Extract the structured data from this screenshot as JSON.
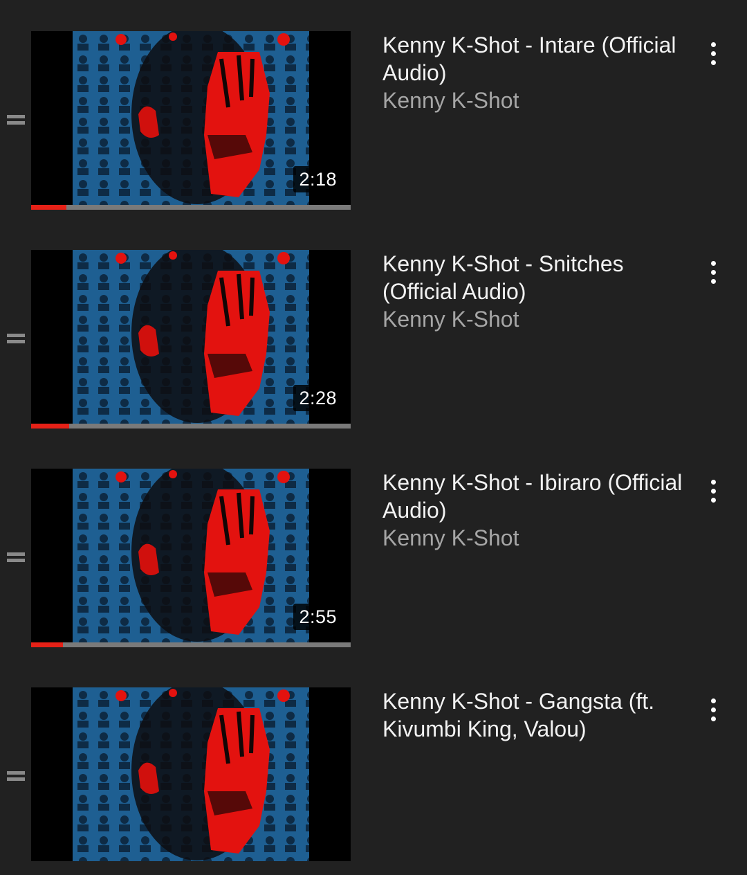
{
  "theme": {
    "background": "#212121",
    "progress_color": "#e62117",
    "progress_track": "#7a7a7a",
    "title_color": "#f2f2f2",
    "channel_color": "#a6a6a6"
  },
  "playlist": {
    "items": [
      {
        "title": "Kenny K-Shot - Intare (Official Audio)",
        "channel": "Kenny K-Shot",
        "duration": "2:18",
        "watched_fraction": 0.11,
        "thumbnail_icon": "kenny-k-shot-cover-art"
      },
      {
        "title": "Kenny K-Shot - Snitches (Official Audio)",
        "channel": "Kenny K-Shot",
        "duration": "2:28",
        "watched_fraction": 0.12,
        "thumbnail_icon": "kenny-k-shot-cover-art"
      },
      {
        "title": "Kenny K-Shot - Ibiraro (Official Audio)",
        "channel": "Kenny K-Shot",
        "duration": "2:55",
        "watched_fraction": 0.1,
        "thumbnail_icon": "kenny-k-shot-cover-art"
      },
      {
        "title": "Kenny K-Shot - Gangsta (ft. Kivumbi King, Valou)",
        "channel": "",
        "duration": "",
        "watched_fraction": null,
        "thumbnail_icon": "kenny-k-shot-cover-art"
      }
    ]
  }
}
